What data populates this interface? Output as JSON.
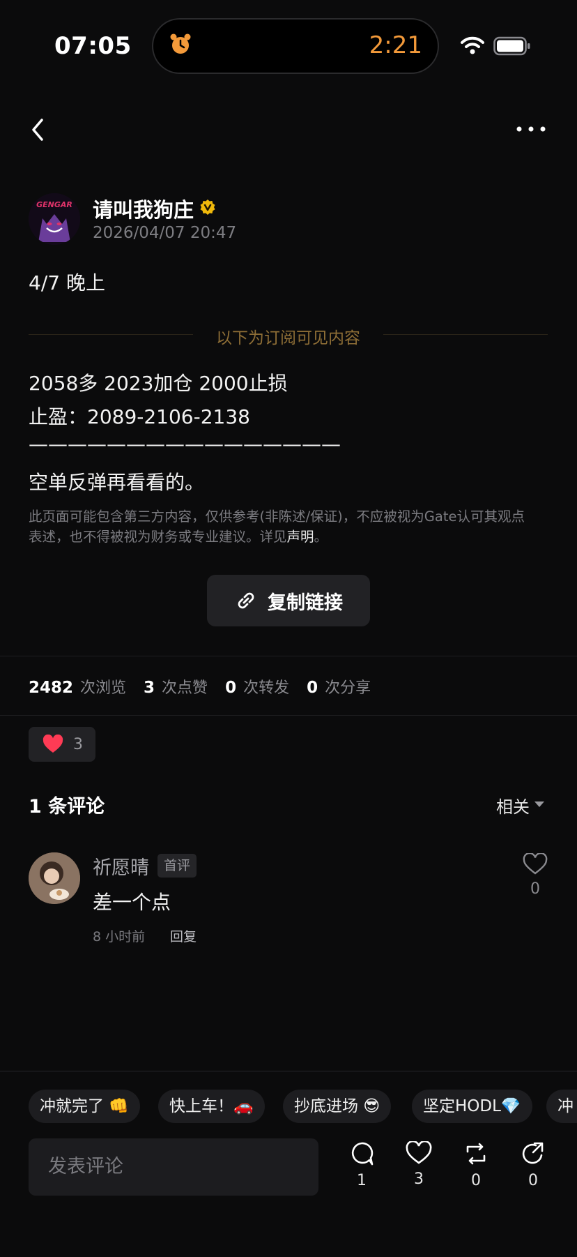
{
  "status_bar": {
    "time": "07:05",
    "timer": "2:21"
  },
  "post": {
    "author": "请叫我狗庄",
    "timestamp": "2026/04/07 20:47",
    "intro": "4/7 晚上",
    "subscriber_divider": "以下为订阅可见内容",
    "lines": [
      "2058多 2023加仓 2000止损",
      "止盈：2089-2106-2138",
      "————————————————",
      "空单反弹再看看的。"
    ],
    "disclaimer_line1": "此页面可能包含第三方内容，仅供参考(非陈述/保证)，不应被视为Gate认可其观点",
    "disclaimer_line2": "表述，也不得被视为财务或专业建议。详见",
    "disclaimer_link": "声明",
    "disclaimer_end": "。",
    "copy_link_label": "复制链接"
  },
  "stats": {
    "views": "2482",
    "views_label": "次浏览",
    "likes": "3",
    "likes_label": "次点赞",
    "reposts": "0",
    "reposts_label": "次转发",
    "shares": "0",
    "shares_label": "次分享"
  },
  "reaction": {
    "count": "3",
    "color": "#ff3b55"
  },
  "comments": {
    "title": "1 条评论",
    "sort": "相关",
    "items": [
      {
        "name": "祈愿晴",
        "tag": "首评",
        "text": "差一个点",
        "time": "8 小时前",
        "reply": "回复",
        "likes": "0"
      }
    ]
  },
  "quick_replies": [
    "冲就完了 👊",
    "快上车！🚗",
    "抄底进场 😎",
    "坚定HODL💎",
    "冲"
  ],
  "composer": {
    "placeholder": "发表评论"
  },
  "actions": {
    "comments": "1",
    "likes": "3",
    "reposts": "0",
    "shares": "0"
  },
  "colors": {
    "accent_gold": "#8e6e36",
    "verified": "#f0b90b",
    "timer": "#f39a3a"
  }
}
